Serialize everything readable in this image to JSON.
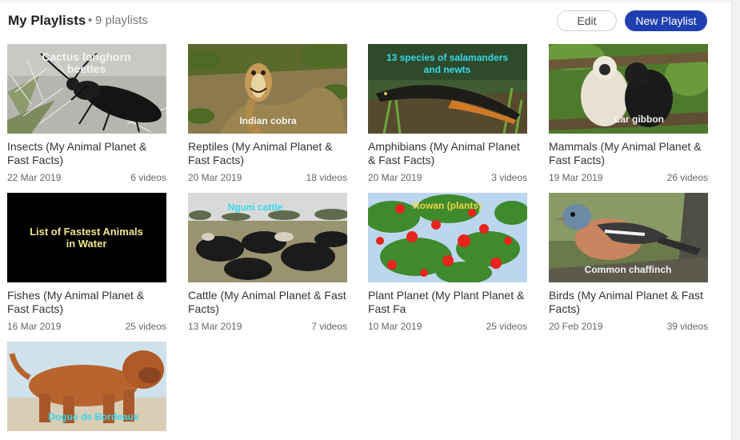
{
  "header": {
    "title": "My Playlists",
    "separator": "•",
    "count": "9 playlists",
    "edit_label": "Edit",
    "new_label": "New Playlist"
  },
  "colors": {
    "accent": "#1f3fb0"
  },
  "playlists": [
    {
      "name": "Insects (My Animal Planet & Fast Facts)",
      "date": "22 Mar 2019",
      "videos": "6 videos",
      "thumb_line1": "Cactus longhorn",
      "thumb_line2": "beetles"
    },
    {
      "name": "Reptiles (My Animal Planet & Fast Facts)",
      "date": "20 Mar 2019",
      "videos": "18 videos",
      "thumb_line1": "Indian cobra"
    },
    {
      "name": "Amphibians (My Animal Planet & Fast Facts)",
      "date": "20 Mar 2019",
      "videos": "3 videos",
      "thumb_line1": "13 species of salamanders",
      "thumb_line2": "and newts"
    },
    {
      "name": "Mammals (My Animal Planet & Fast Facts)",
      "date": "19 Mar 2019",
      "videos": "26 videos",
      "thumb_line1": "Lar gibbon"
    },
    {
      "name": "Fishes (My Animal Planet & Fast Facts)",
      "date": "16 Mar 2019",
      "videos": "25 videos",
      "thumb_line1": "List of Fastest Animals",
      "thumb_line2": "in Water"
    },
    {
      "name": "Cattle (My Animal Planet & Fast Facts)",
      "date": "13 Mar 2019",
      "videos": "7 videos",
      "thumb_line1": "Nguni cattle"
    },
    {
      "name": "Plant Planet (My Plant Planet & Fast Fa",
      "date": "10 Mar 2019",
      "videos": "25 videos",
      "thumb_line1": "Rowan (plants)"
    },
    {
      "name": "Birds (My Animal Planet & Fast Facts)",
      "date": "20 Feb 2019",
      "videos": "39 videos",
      "thumb_line1": "Common chaffinch"
    },
    {
      "thumb_line1": "Dogue de Bordeaux"
    }
  ]
}
